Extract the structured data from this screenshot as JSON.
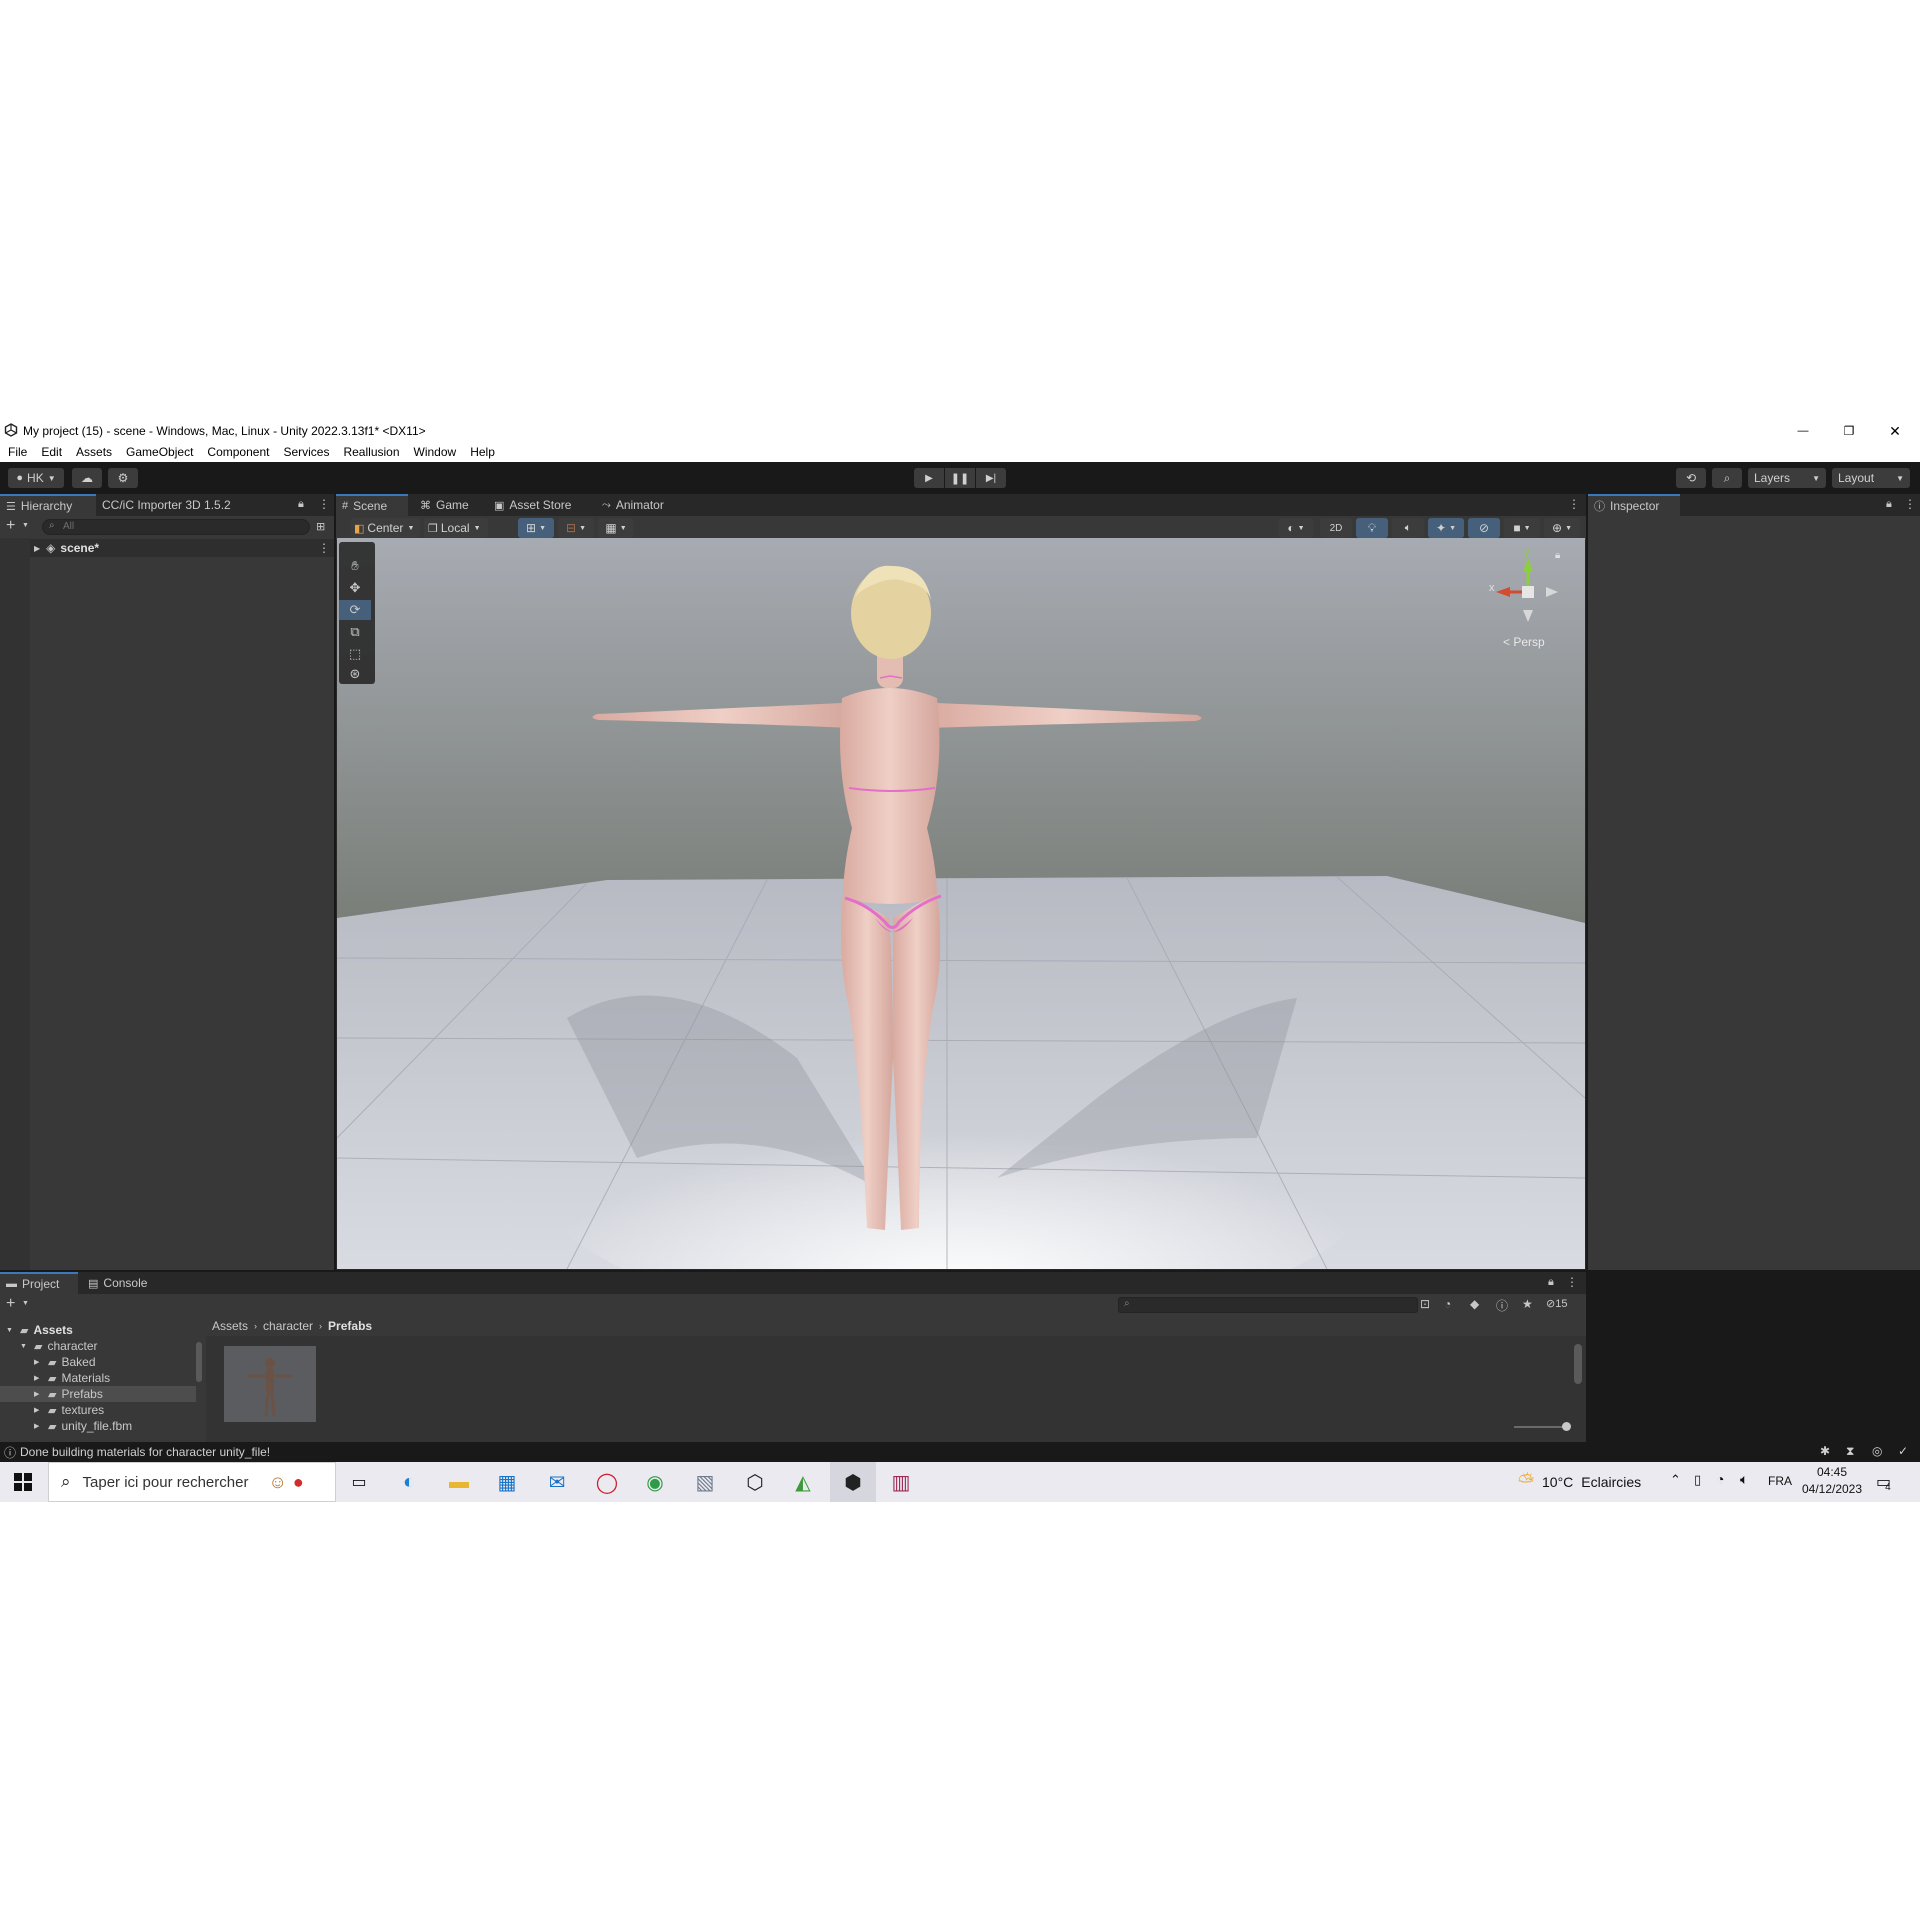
{
  "window": {
    "title": "My project (15) - scene - Windows, Mac, Linux - Unity 2022.3.13f1* <DX11>",
    "controls": {
      "minimize": "—",
      "maximize": "❐",
      "close": "✕"
    }
  },
  "menu": [
    "File",
    "Edit",
    "Assets",
    "GameObject",
    "Component",
    "Services",
    "Reallusion",
    "Window",
    "Help"
  ],
  "toolbar": {
    "account": "HK",
    "layers_label": "Layers",
    "layout_label": "Layout"
  },
  "hierarchy": {
    "tabs": [
      "Hierarchy",
      "CC/iC Importer 3D 1.5.2"
    ],
    "search_placeholder": "All",
    "root_item": "scene*"
  },
  "scene": {
    "tabs": [
      "Scene",
      "Game",
      "Asset Store",
      "Animator"
    ],
    "pivot_mode": "Center",
    "pivot_rotation": "Local",
    "mode_2d": "2D",
    "gizmo": {
      "y": "y",
      "x": "x",
      "persp": "< Persp"
    }
  },
  "inspector": {
    "tab": "Inspector"
  },
  "project": {
    "tabs": [
      "Project",
      "Console"
    ],
    "hidden_count": "15",
    "tree": [
      {
        "label": "Assets",
        "depth": 0,
        "bold": true,
        "expanded": true
      },
      {
        "label": "character",
        "depth": 1,
        "bold": false,
        "expanded": true
      },
      {
        "label": "Baked",
        "depth": 2,
        "bold": false,
        "expanded": false
      },
      {
        "label": "Materials",
        "depth": 2,
        "bold": false,
        "expanded": false
      },
      {
        "label": "Prefabs",
        "depth": 2,
        "bold": false,
        "expanded": false,
        "selected": true
      },
      {
        "label": "textures",
        "depth": 2,
        "bold": false,
        "expanded": false
      },
      {
        "label": "unity_file.fbm",
        "depth": 2,
        "bold": false,
        "expanded": false
      }
    ],
    "breadcrumb": [
      "Assets",
      "character",
      "Prefabs"
    ]
  },
  "status": {
    "message": "Done building materials for character unity_file!"
  },
  "taskbar": {
    "search_placeholder": "Taper ici pour rechercher",
    "weather_temp": "10°C",
    "weather_desc": "Eclaircies",
    "language": "FRA",
    "time": "04:45",
    "date": "04/12/2023",
    "notifications": "4"
  },
  "colors": {
    "accent": "#3a79bb",
    "editor_bg": "#383838",
    "toolbar_bg": "#191919",
    "tab_strip": "#282828",
    "sky_top": "#a6aab0",
    "sky_horizon": "#6a6b5a",
    "floor": "#c8cbd3",
    "skin": "#e8c4b9",
    "bikini": "#e36fc9",
    "hair": "#e4d3a0"
  }
}
